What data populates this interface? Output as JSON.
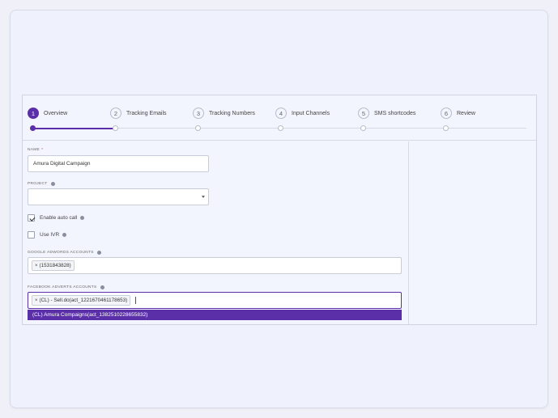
{
  "stepper": {
    "steps": [
      {
        "num": "1",
        "label": "Overview"
      },
      {
        "num": "2",
        "label": "Tracking Emails"
      },
      {
        "num": "3",
        "label": "Tracking Numbers"
      },
      {
        "num": "4",
        "label": "Input Channels"
      },
      {
        "num": "5",
        "label": "SMS shortcodes"
      },
      {
        "num": "6",
        "label": "Review"
      }
    ],
    "active_step": 1
  },
  "form": {
    "name_label": "NAME",
    "name_required": "*",
    "name_value": "Amura Digital Campaign",
    "project_label": "PROJECT",
    "project_value": "",
    "auto_call_label": "Enable auto call",
    "auto_call_checked": true,
    "ivr_label": "Use IVR",
    "ivr_checked": false,
    "adwords_label": "GOOGLE ADWORDS ACCOUNTS",
    "adwords_tags": [
      "(1531843828)"
    ],
    "facebook_label": "FACEBOOK ADVERTS ACCOUNTS",
    "facebook_tags": [
      "(CL) - Sell.do(act_1221670461178653)"
    ],
    "facebook_dropdown_option": "(CL) Amura Compaigns(act_1382510228655832)"
  },
  "colors": {
    "accent": "#5b2fa8",
    "background": "#eff2fd"
  }
}
